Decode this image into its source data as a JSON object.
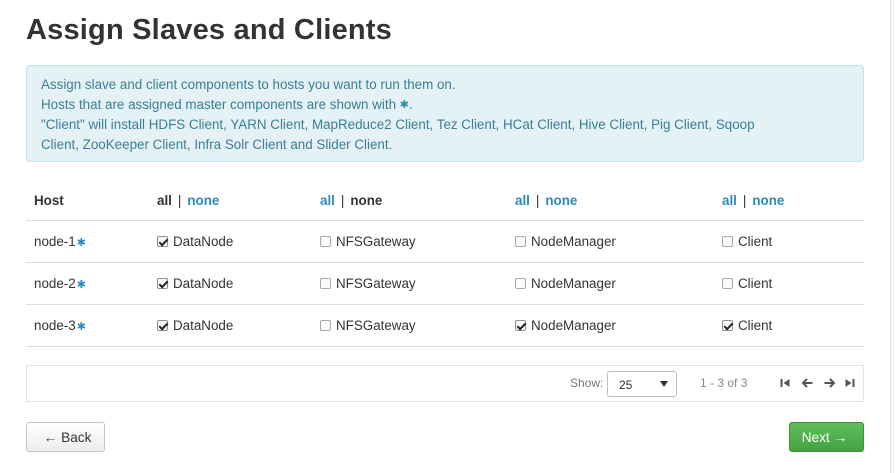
{
  "page": {
    "title": "Assign Slaves and Clients"
  },
  "info": {
    "line1": "Assign slave and client components to hosts you want to run them on.",
    "line2_prefix": "Hosts that are assigned master components are shown with",
    "line2_suffix": ".",
    "line3": "\"Client\" will install HDFS Client, YARN Client, MapReduce2 Client, Tez Client, HCat Client, Hive Client, Pig Client, Sqoop",
    "line4": "Client, ZooKeeper Client, Infra Solr Client and Slider Client.",
    "star_glyph": "✱"
  },
  "table": {
    "host_header": "Host",
    "all_label": "all",
    "none_label": "none",
    "separator": "|",
    "components": [
      "DataNode",
      "NFSGateway",
      "NodeManager",
      "Client"
    ],
    "rows": [
      {
        "host": "node-1",
        "checks": [
          true,
          false,
          false,
          false
        ]
      },
      {
        "host": "node-2",
        "checks": [
          true,
          false,
          false,
          false
        ]
      },
      {
        "host": "node-3",
        "checks": [
          true,
          false,
          true,
          true
        ]
      }
    ]
  },
  "pagination": {
    "show_label": "Show:",
    "page_size": "25",
    "range_text": "1 - 3 of 3"
  },
  "buttons": {
    "back_label": "Back",
    "next_label": "Next",
    "back_arrow": "←",
    "next_arrow": "→"
  },
  "colors": {
    "link": "#2a8bba",
    "alert_bg": "#e4f1f5",
    "alert_text": "#3a7f96",
    "next_button": "#4cae4a"
  },
  "icons": [
    "first-page-icon",
    "prev-page-icon",
    "next-page-icon",
    "last-page-icon",
    "master-component-star-icon"
  ]
}
